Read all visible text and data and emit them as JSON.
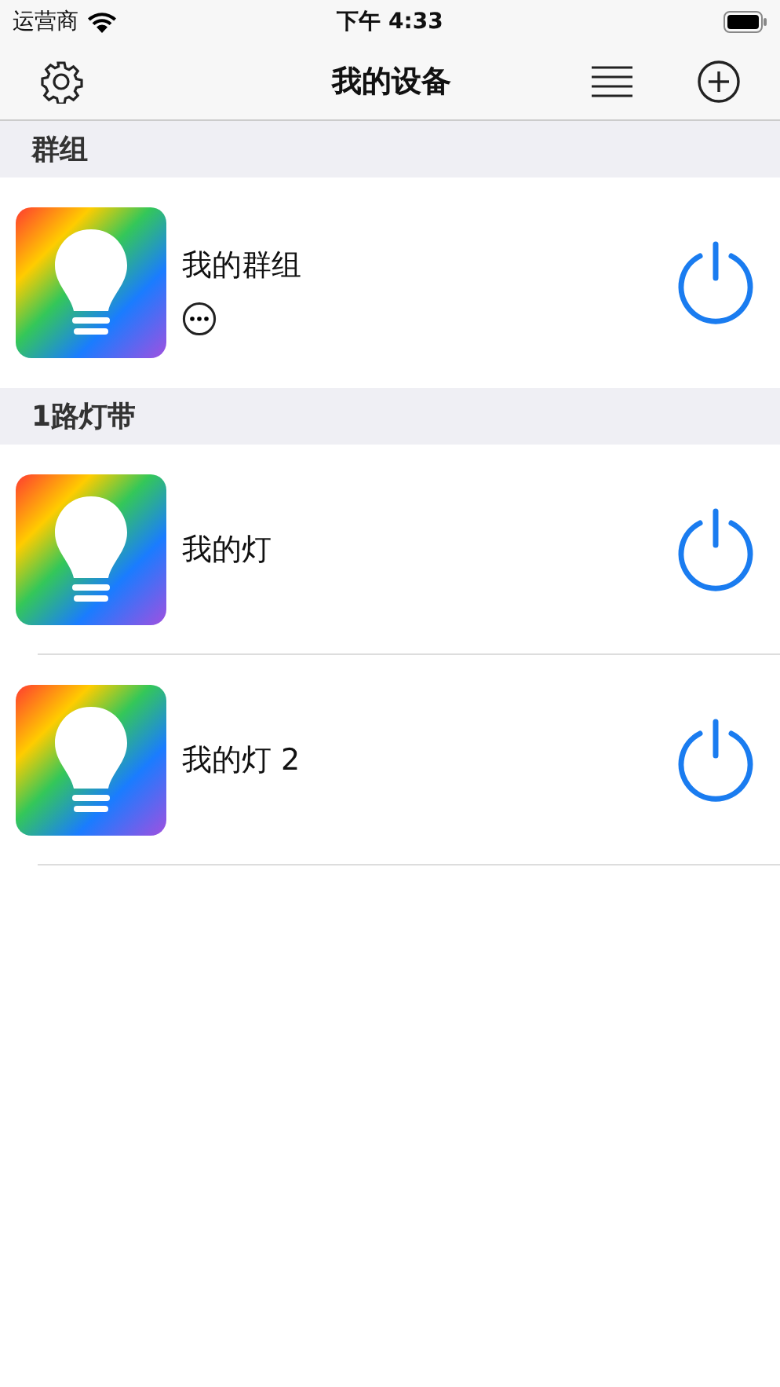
{
  "status_bar": {
    "carrier": "运营商",
    "time": "下午 4:33"
  },
  "nav_bar": {
    "title": "我的设备"
  },
  "sections": [
    {
      "title": "群组",
      "items": [
        {
          "kind": "group",
          "name": "我的群组"
        }
      ]
    },
    {
      "title": "1路灯带",
      "items": [
        {
          "kind": "light",
          "name": "我的灯"
        },
        {
          "kind": "light",
          "name": "我的灯 2"
        }
      ]
    }
  ]
}
